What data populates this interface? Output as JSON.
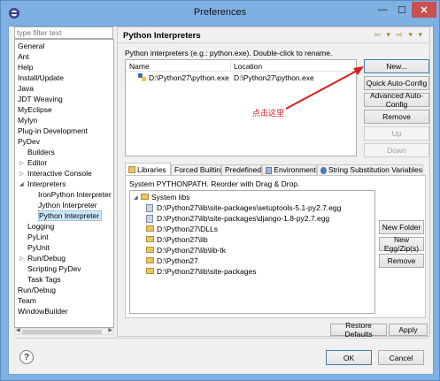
{
  "window": {
    "title": "Preferences",
    "minimize": "—",
    "maximize": "☐",
    "close": "✕"
  },
  "filter": {
    "placeholder": "type filter text"
  },
  "tree": {
    "items": [
      {
        "label": "General",
        "level": 0
      },
      {
        "label": "Ant",
        "level": 0
      },
      {
        "label": "Help",
        "level": 0
      },
      {
        "label": "Install/Update",
        "level": 0
      },
      {
        "label": "Java",
        "level": 0
      },
      {
        "label": "JDT Weaving",
        "level": 0
      },
      {
        "label": "MyEclipse",
        "level": 0
      },
      {
        "label": "Mylyn",
        "level": 0
      },
      {
        "label": "Plug-in Development",
        "level": 0
      },
      {
        "label": "PyDev",
        "level": 0,
        "expanded": true
      },
      {
        "label": "Builders",
        "level": 1
      },
      {
        "label": "Editor",
        "level": 1,
        "twisty": "▷"
      },
      {
        "label": "Interactive Console",
        "level": 1,
        "twisty": "▷"
      },
      {
        "label": "Interpreters",
        "level": 1,
        "twisty": "◢"
      },
      {
        "label": "IronPython Interpreter",
        "level": 2
      },
      {
        "label": "Jython Interpreter",
        "level": 2
      },
      {
        "label": "Python Interpreter",
        "level": 2,
        "selected": true
      },
      {
        "label": "Logging",
        "level": 1
      },
      {
        "label": "PyLint",
        "level": 1
      },
      {
        "label": "PyUnit",
        "level": 1
      },
      {
        "label": "Run/Debug",
        "level": 1,
        "twisty": "▷"
      },
      {
        "label": "Scripting PyDev",
        "level": 1
      },
      {
        "label": "Task Tags",
        "level": 1
      },
      {
        "label": "Run/Debug",
        "level": 0
      },
      {
        "label": "Team",
        "level": 0
      },
      {
        "label": "WindowBuilder",
        "level": 0
      }
    ]
  },
  "panel": {
    "title": "Python Interpreters",
    "nav": "⇦ ▾ ⇨ ▾ ▾",
    "description": "Python interpreters (e.g.: python.exe).   Double-click to rename.",
    "table": {
      "col_name": "Name",
      "col_location": "Location",
      "rows": [
        {
          "name": "D:\\Python27\\python.exe",
          "location": "D:\\Python27\\python.exe"
        }
      ]
    },
    "buttons": {
      "new": "New...",
      "quick": "Quick Auto-Config",
      "advanced": "Advanced Auto-Config",
      "remove": "Remove",
      "up": "Up",
      "down": "Down"
    },
    "annotation": "点击这里",
    "annotation_color": "#e0191b"
  },
  "tabs": [
    {
      "label": "Libraries",
      "active": true
    },
    {
      "label": "Forced Builtins"
    },
    {
      "label": "Predefined"
    },
    {
      "label": "Environment"
    },
    {
      "label": "String Substitution Variables"
    }
  ],
  "libraries": {
    "system_path_label": "System PYTHONPATH.   Reorder with Drag & Drop.",
    "root": "System libs",
    "items": [
      "D:\\Python27\\lib\\site-packages\\setuptools-5.1-py2.7.egg",
      "D:\\Python27\\lib\\site-packages\\django-1.8-py2.7.egg",
      "D:\\Python27\\DLLs",
      "D:\\Python27\\lib",
      "D:\\Python27\\lib\\lib-tk",
      "D:\\Python27",
      "D:\\Python27\\lib\\site-packages"
    ],
    "buttons": {
      "new_folder": "New Folder",
      "new_egg": "New Egg/Zip(s)",
      "remove": "Remove"
    }
  },
  "footer": {
    "restore_defaults": "Restore Defaults",
    "apply": "Apply",
    "ok": "OK",
    "cancel": "Cancel",
    "help": "?"
  }
}
